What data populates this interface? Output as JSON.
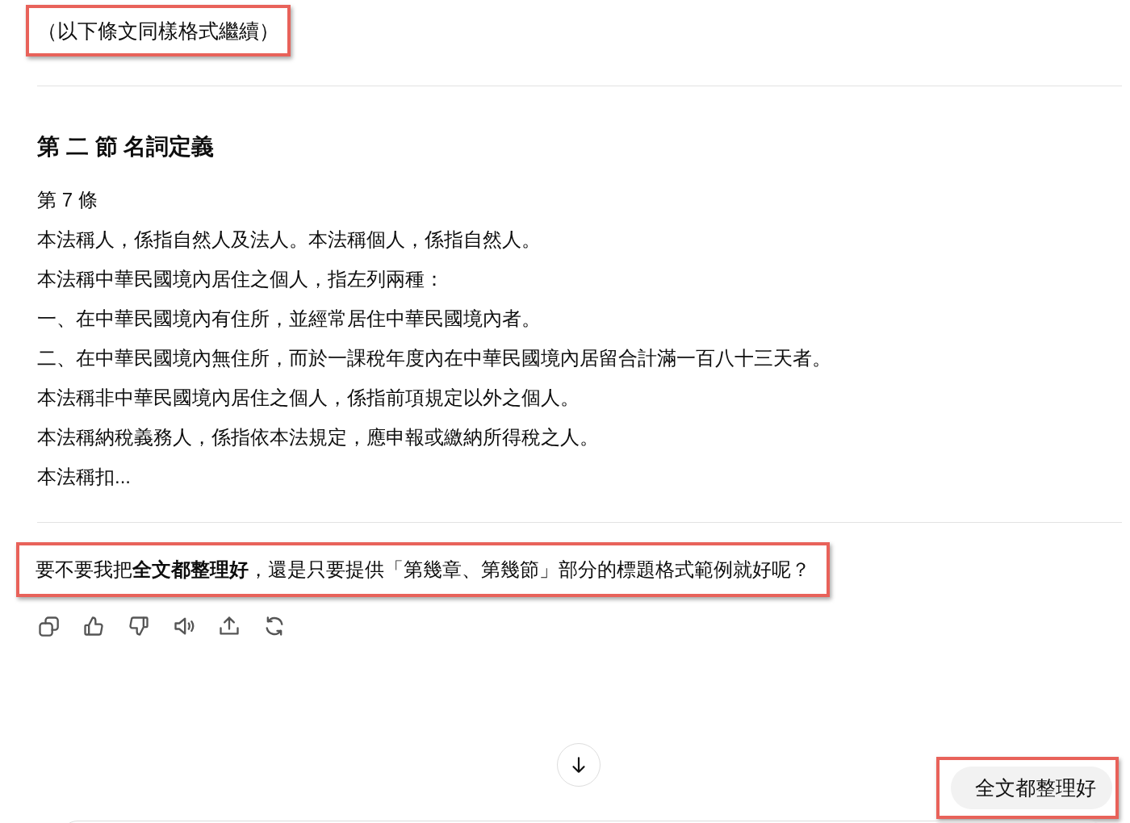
{
  "note": {
    "text": "（以下條文同樣格式繼續）",
    "highlighted": true
  },
  "section": {
    "heading": "第 二 節 名詞定義",
    "lines": [
      "第 7 條",
      "本法稱人，係指自然人及法人。本法稱個人，係指自然人。",
      "本法稱中華民國境內居住之個人，指左列兩種：",
      "一、在中華民國境內有住所，並經常居住中華民國境內者。",
      "二、在中華民國境內無住所，而於一課稅年度內在中華民國境內居留合計滿一百八十三天者。",
      "本法稱非中華民國境內居住之個人，係指前項規定以外之個人。",
      "本法稱納稅義務人，係指依本法規定，應申報或繳納所得稅之人。",
      "本法稱扣..."
    ]
  },
  "question": {
    "text": "要不要我把**全文都整理好**，還是只要提供「第幾章、第幾節」部分的標題格式範例就好呢？",
    "highlighted": true
  },
  "actions": [
    {
      "kind": "copy"
    },
    {
      "kind": "like"
    },
    {
      "kind": "dislike"
    },
    {
      "kind": "speak"
    },
    {
      "kind": "share"
    },
    {
      "kind": "regenerate"
    }
  ],
  "suggestion": {
    "label": "全文都整理好",
    "highlighted": true
  }
}
